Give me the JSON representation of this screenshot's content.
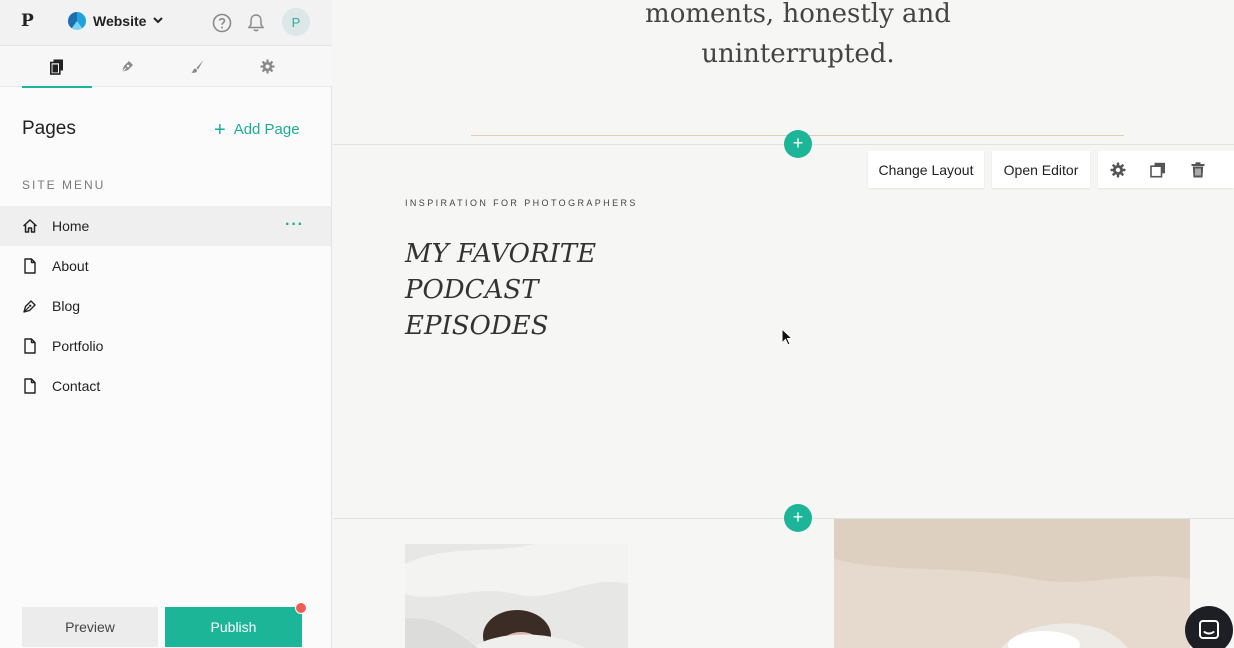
{
  "app": {
    "logo": "P",
    "site_name": "Website",
    "avatar_initial": "P"
  },
  "sidebar": {
    "tabs": [
      {
        "name": "pages",
        "icon": "pages-icon"
      },
      {
        "name": "blog",
        "icon": "pen-nib-icon"
      },
      {
        "name": "design",
        "icon": "brush-icon"
      },
      {
        "name": "settings",
        "icon": "gear-icon"
      }
    ],
    "pages_title": "Pages",
    "add_page_label": "Add Page",
    "section_label": "SITE MENU",
    "items": [
      {
        "label": "Home",
        "icon": "home-icon"
      },
      {
        "label": "About",
        "icon": "page-icon"
      },
      {
        "label": "Blog",
        "icon": "pen-icon"
      },
      {
        "label": "Portfolio",
        "icon": "page-icon"
      },
      {
        "label": "Contact",
        "icon": "page-icon"
      }
    ],
    "more_dots": "···",
    "preview_label": "Preview",
    "publish_label": "Publish"
  },
  "canvas": {
    "hero_line1": "moments, honestly and",
    "hero_line2": "uninterrupted.",
    "add_section": "+",
    "toolbar": {
      "change_layout": "Change Layout",
      "open_editor": "Open Editor"
    },
    "eyebrow": "INSPIRATION FOR PHOTOGRAPHERS",
    "headline": [
      "MY FAVORITE",
      "PODCAST",
      "EPISODES"
    ]
  },
  "colors": {
    "accent": "#1cb598",
    "notification": "#f15d55",
    "rule": "#e0cdb5"
  }
}
